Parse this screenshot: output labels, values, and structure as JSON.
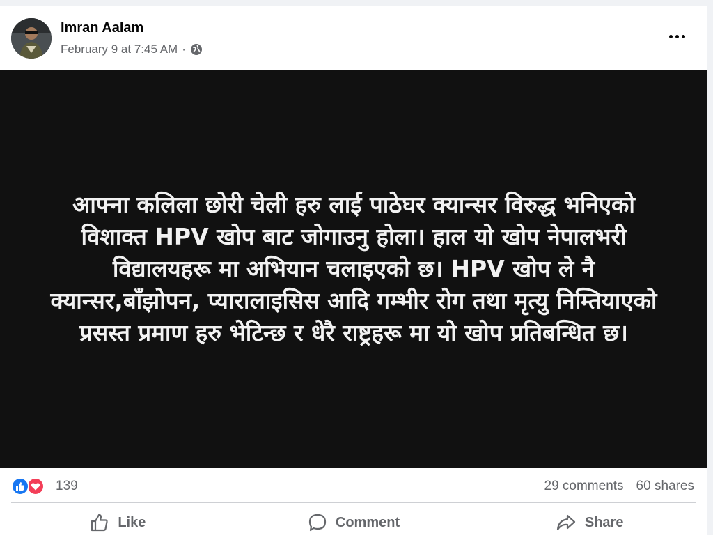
{
  "post": {
    "author": "Imran Aalam",
    "timestamp": "February 9 at 7:45 AM",
    "separator": "·",
    "privacy_icon": "globe-icon",
    "more_icon": "more-options-icon",
    "image_text_lines": [
      "आफ्ना कलिला छोरी चेली हरु लाई पाठेघर क्यान्सर विरुद्ध भनिएको",
      "विशाक्त HPV खोप बाट जोगाउनु होला। हाल यो खोप नेपालभरी",
      "विद्यालयहरू मा अभियान चलाइएको छ। HPV खोप ले नै",
      "क्यान्सर,बाँझोपन, प्यारालाइसिस आदि गम्भीर रोग तथा मृत्यु निम्तियाएको",
      "प्रसस्त प्रमाण हरु भेटिन्छ र धेरै राष्ट्रहरू मा यो खोप प्रतिबन्धित छ।"
    ],
    "image_background": "#111111"
  },
  "reactions": {
    "count": "139",
    "icons": [
      "like-reaction-icon",
      "love-reaction-icon"
    ],
    "like_color": "#1877f2",
    "love_color": "#f33e58"
  },
  "stats": {
    "comments": "29 comments",
    "shares": "60 shares"
  },
  "actions": {
    "like_label": "Like",
    "comment_label": "Comment",
    "share_label": "Share"
  }
}
